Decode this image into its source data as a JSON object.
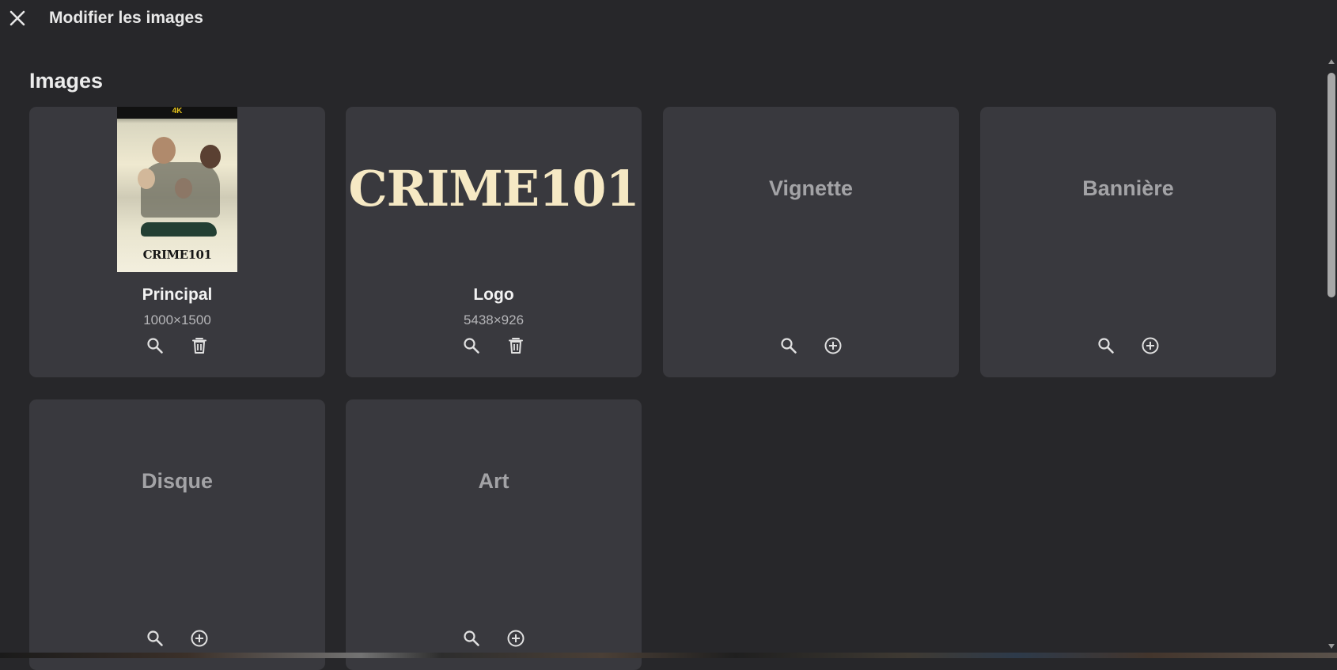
{
  "header": {
    "title": "Modifier les images",
    "close_icon": "close-icon"
  },
  "section": {
    "title": "Images"
  },
  "cards": [
    {
      "label": "Principal",
      "dims": "1000×1500",
      "has_image": true,
      "actions": [
        "search-icon",
        "delete-icon"
      ],
      "poster_text": "CRIME101",
      "poster_badge": "4K"
    },
    {
      "label": "Logo",
      "dims": "5438×926",
      "has_image": true,
      "actions": [
        "search-icon",
        "delete-icon"
      ],
      "logo_text": "CRIME101"
    },
    {
      "label": "Vignette",
      "has_image": false,
      "actions": [
        "search-icon",
        "add-icon"
      ]
    },
    {
      "label": "Bannière",
      "has_image": false,
      "actions": [
        "search-icon",
        "add-icon"
      ]
    },
    {
      "label": "Disque",
      "has_image": false,
      "actions": [
        "search-icon",
        "add-icon"
      ]
    },
    {
      "label": "Art",
      "has_image": false,
      "actions": [
        "search-icon",
        "add-icon"
      ]
    }
  ],
  "colors": {
    "background": "#27272a",
    "card": "#39393e",
    "placeholder_text": "#a3a3a6"
  }
}
